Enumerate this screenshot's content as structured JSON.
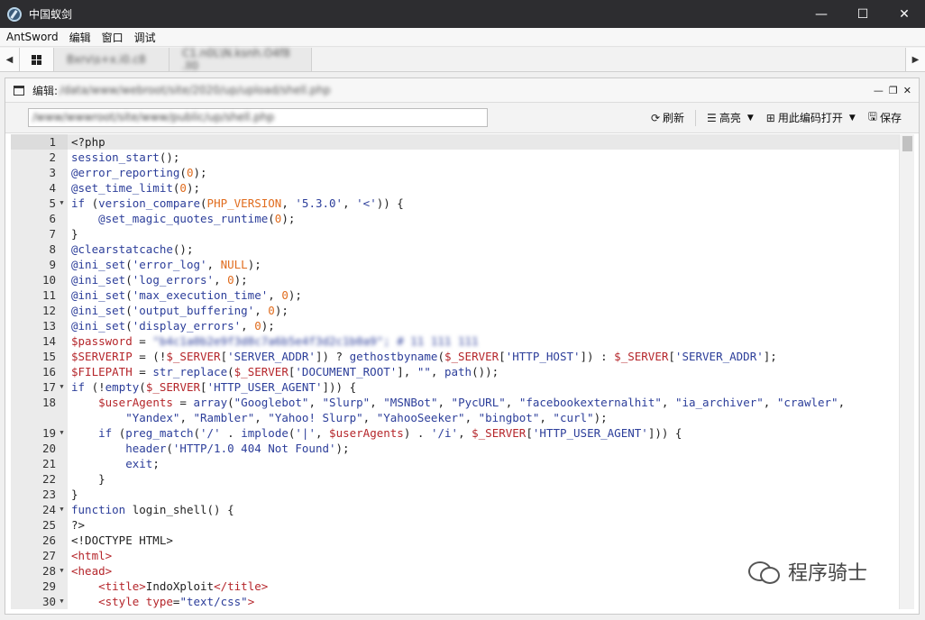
{
  "window": {
    "title": "中国蚁剑",
    "controls": [
      "—",
      "☐",
      "✕"
    ]
  },
  "menu": [
    "AntSword",
    "编辑",
    "窗口",
    "调试"
  ],
  "tabs": {
    "left_arrow": "◀",
    "right_arrow": "▶",
    "items": [
      "Bxrv\\s+x.i0.c8",
      "C1.n0L\\N.ksnh.O4f8 .ll0"
    ]
  },
  "panel": {
    "title_label": "编辑:",
    "title_path": "/data/www/webroot/site/2020/up/upload/shell.php",
    "controls": [
      "—",
      "❐",
      "✕"
    ]
  },
  "toolbar": {
    "path_value": "/www/wwwroot/site/www/public/up/shell.php",
    "refresh_label": "刷新",
    "highlight_label": "高亮",
    "encoding_label": "用此编码打开",
    "save_label": "保存"
  },
  "editor": {
    "folds": {
      "5": "▼",
      "17": "▼",
      "19": "▼",
      "24": "▼",
      "28": "▼",
      "30": "▼"
    },
    "line_numbers": [
      "1",
      "2",
      "3",
      "4",
      "5",
      "6",
      "7",
      "8",
      "9",
      "10",
      "11",
      "12",
      "13",
      "14",
      "15",
      "16",
      "17",
      "18",
      "",
      "19",
      "20",
      "21",
      "22",
      "23",
      "24",
      "25",
      "26",
      "27",
      "28",
      "29",
      "30"
    ]
  },
  "watermark": {
    "text": "程序骑士"
  }
}
